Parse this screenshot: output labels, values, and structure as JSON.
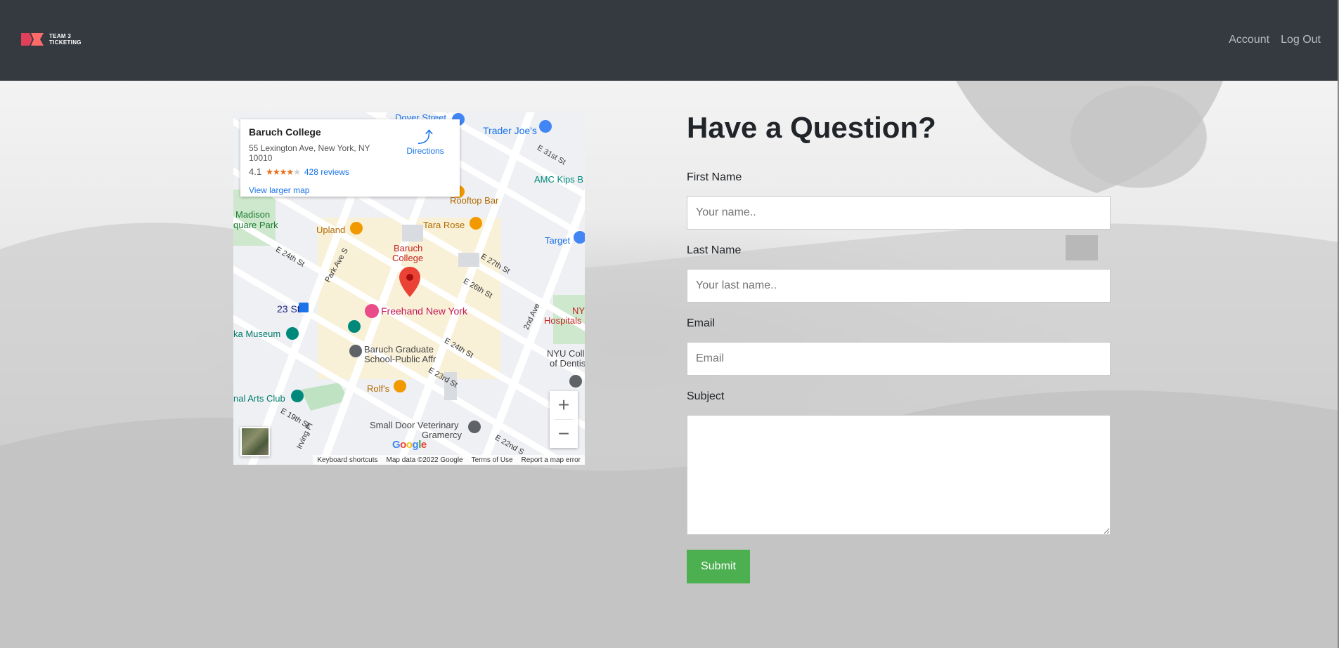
{
  "header": {
    "logo_text_line1": "TEAM 3",
    "logo_text_line2": "TICKETING",
    "nav": [
      {
        "label": "Account"
      },
      {
        "label": "Log Out"
      }
    ]
  },
  "map": {
    "place_name": "Baruch College",
    "address": "55 Lexington Ave, New York, NY 10010",
    "rating": "4.1",
    "rating_stars_filled": 4,
    "reviews_link": "428 reviews",
    "directions_label": "Directions",
    "view_larger": "View larger map",
    "labels": {
      "dover": "Dover Street",
      "traderjoes": "Trader Joe's",
      "e31": "E 31st St",
      "amc": "AMC Kips B",
      "rooftop": "Rooftop Bar",
      "upland": "Upland",
      "tararose": "Tara Rose",
      "target": "Target",
      "madison": "Madison",
      "square_park": "quare Park",
      "baruch_pin_1": "Baruch",
      "baruch_pin_2": "College",
      "e24": "E 24th St",
      "parkave": "Park Ave S",
      "e27": "E 27th St",
      "e26": "E 26th St",
      "st23": "23 St",
      "freehand": "Freehand New York",
      "ny_hosp1": "NY",
      "ny_hosp2": "Hospitals",
      "museum": "ka Museum",
      "baruch_grad_1": "Baruch Graduate",
      "baruch_grad_2": "School-Public Affr",
      "nyu1": "NYU Coll",
      "nyu2": "of Dentis",
      "e24b": "E 24th St",
      "e23": "E 23rd St",
      "secondave": "2nd Ave",
      "rolfs": "Rolf's",
      "arts": "nal Arts Club",
      "e19": "E 19th St",
      "irving": "Irving Pl",
      "vet1": "Small Door Veterinary",
      "vet2": "Gramercy",
      "e22": "E 22nd S"
    },
    "zoom_in": "+",
    "zoom_out": "−",
    "google": "Google",
    "footer": [
      "Keyboard shortcuts",
      "Map data ©2022 Google",
      "Terms of Use",
      "Report a map error"
    ]
  },
  "form": {
    "title": "Have a Question?",
    "first_name_label": "First Name",
    "first_name_placeholder": "Your name..",
    "last_name_label": "Last Name",
    "last_name_placeholder": "Your last name..",
    "email_label": "Email",
    "email_placeholder": "Email",
    "subject_label": "Subject",
    "subject_value": "",
    "submit_label": "Submit"
  }
}
